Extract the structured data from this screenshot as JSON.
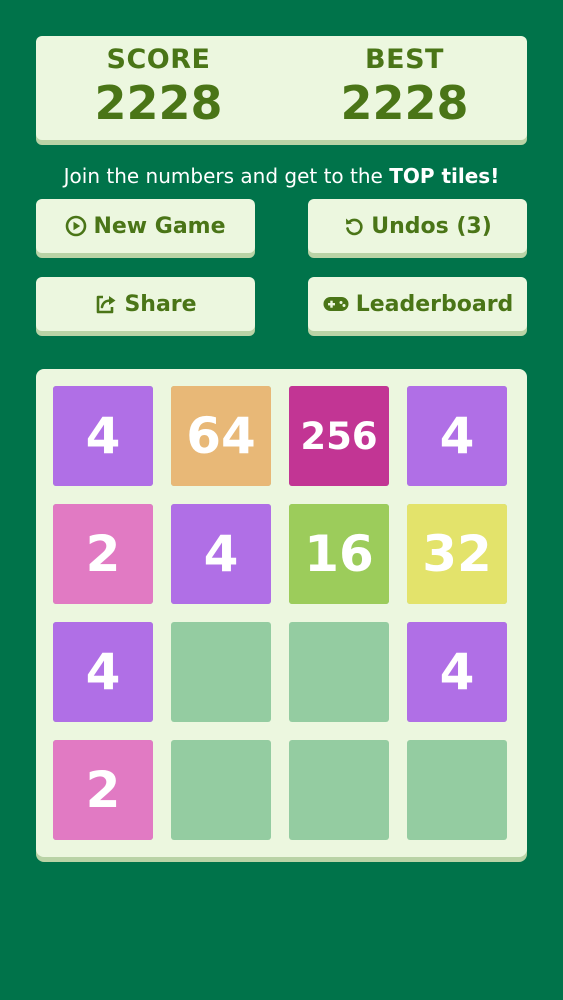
{
  "scoreboard": {
    "score_label": "SCORE",
    "score_value": "2228",
    "best_label": "BEST",
    "best_value": "2228"
  },
  "tagline": {
    "prefix": "Join the numbers and get to the ",
    "emphasis": "TOP tiles!"
  },
  "buttons": {
    "new_game": "New Game",
    "undos": "Undos (3)",
    "share": "Share",
    "leaderboard": "Leaderboard"
  },
  "icons": {
    "new_game": "play-circle-icon",
    "undos": "undo-icon",
    "share": "share-icon",
    "leaderboard": "gamepad-icon"
  },
  "board": {
    "rows": [
      [
        "4",
        "64",
        "256",
        "4"
      ],
      [
        "2",
        "4",
        "16",
        "32"
      ],
      [
        "4",
        "",
        "",
        "4"
      ],
      [
        "2",
        "",
        "",
        ""
      ]
    ]
  },
  "colors": {
    "background": "#00734a",
    "panel": "#ecf7df",
    "panel_text": "#4a7517",
    "empty_cell": "#94cca1",
    "tile_2": "#e17ac3",
    "tile_4": "#b06fe6",
    "tile_16": "#9ccc5b",
    "tile_32": "#e3e36b",
    "tile_64": "#e8b877",
    "tile_256": "#c23594"
  }
}
